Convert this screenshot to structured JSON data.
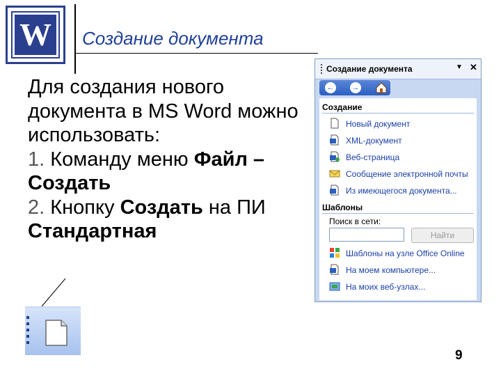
{
  "slide": {
    "title": "Создание документа",
    "intro": "Для создания нового документа в MS Word можно использовать:",
    "point1_num": "1.",
    "point1_text": "Команду меню ",
    "point1_bold": "Файл – Создать",
    "point2_num": "2.",
    "point2_text": "Кнопку ",
    "point2_bold": "Создать",
    "point2_tail": " на ПИ ",
    "point2_bold2": "Стандартная",
    "page_number": "9",
    "logo_letter": "W"
  },
  "task_pane": {
    "title": "Создание документа",
    "section_create": "Создание",
    "create_items": [
      {
        "label": "Новый документ",
        "icon": "blank-doc-icon"
      },
      {
        "label": "XML-документ",
        "icon": "xml-doc-icon"
      },
      {
        "label": "Веб-страница",
        "icon": "web-page-icon"
      },
      {
        "label": "Сообщение электронной почты",
        "icon": "email-icon"
      },
      {
        "label": "Из имеющегося документа...",
        "icon": "existing-doc-icon"
      }
    ],
    "section_templates": "Шаблоны",
    "search_label": "Поиск в сети:",
    "search_value": "",
    "search_button": "Найти",
    "template_items": [
      {
        "label": "Шаблоны на узле Office Online",
        "icon": "office-online-icon"
      },
      {
        "label": "На моем компьютере...",
        "icon": "my-computer-icon"
      },
      {
        "label": "На моих веб-узлах...",
        "icon": "my-websites-icon"
      }
    ]
  },
  "colors": {
    "title": "#1f3f99",
    "link": "#1a3fa8",
    "logo": "#2b3f8f"
  }
}
